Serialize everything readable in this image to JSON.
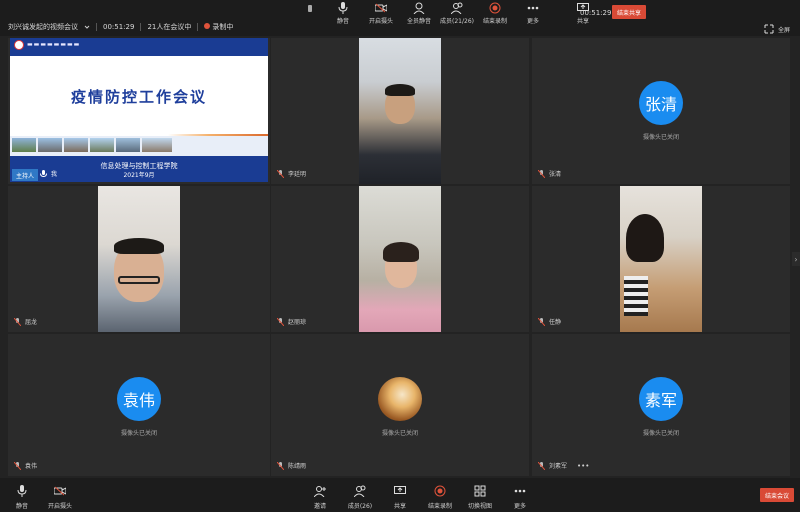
{
  "meeting": {
    "title": "刘兴诚发起的视频会议",
    "duration": "00:51:29",
    "participants_in_meeting": "21人在会议中",
    "recording_status": "录制中"
  },
  "top_toolbar": {
    "items": [
      {
        "label": "静音",
        "icon": "mic-icon"
      },
      {
        "label": "开启摄头",
        "icon": "camera-off-icon"
      },
      {
        "label": "全员静音",
        "icon": "mute-all-icon"
      },
      {
        "label": "成员(21/26)",
        "icon": "members-icon"
      },
      {
        "label": "结束录制",
        "icon": "record-stop-icon"
      },
      {
        "label": "更多",
        "icon": "more-icon"
      },
      {
        "label": "共享",
        "icon": "share-icon"
      }
    ],
    "share_time": "00:51:29",
    "end_share_label": "结束共享",
    "fullscreen_label": "全屏"
  },
  "slide": {
    "title": "疫情防控工作会议",
    "department": "信息处理与控制工程学院",
    "date": "2021年9月",
    "host_badge": "主持人",
    "presenter_name": "我"
  },
  "tiles": [
    {
      "name": "李廷明",
      "camera": "on"
    },
    {
      "name": "张清",
      "camera": "off",
      "avatar_text": "张清",
      "cam_status": "摄像头已关闭"
    },
    {
      "name": "屈龙",
      "camera": "on"
    },
    {
      "name": "赵丽琼",
      "camera": "on"
    },
    {
      "name": "任静",
      "camera": "on"
    },
    {
      "name": "袁伟",
      "camera": "off",
      "avatar_text": "袁伟",
      "cam_status": "摄像头已关闭"
    },
    {
      "name": "陈靖雨",
      "camera": "off",
      "avatar_text": "",
      "cam_status": "摄像头已关闭"
    },
    {
      "name": "刘素军",
      "camera": "off",
      "avatar_text": "素军",
      "cam_status": "摄像头已关闭",
      "extra": "•••"
    }
  ],
  "bottom_toolbar": {
    "items": [
      {
        "label": "静音",
        "icon": "mic-icon"
      },
      {
        "label": "开启摄头",
        "icon": "camera-off-icon"
      },
      {
        "label": "邀请",
        "icon": "invite-icon"
      },
      {
        "label": "成员(26)",
        "icon": "members-icon"
      },
      {
        "label": "共享",
        "icon": "share-icon"
      },
      {
        "label": "结束录制",
        "icon": "record-stop-icon"
      },
      {
        "label": "切换视图",
        "icon": "grid-view-icon"
      },
      {
        "label": "更多",
        "icon": "more-icon"
      }
    ],
    "end_meeting_label": "结束会议"
  },
  "colors": {
    "accent_blue": "#1a8cf0",
    "end_red": "#d94a36",
    "slide_blue": "#1a3c93"
  }
}
